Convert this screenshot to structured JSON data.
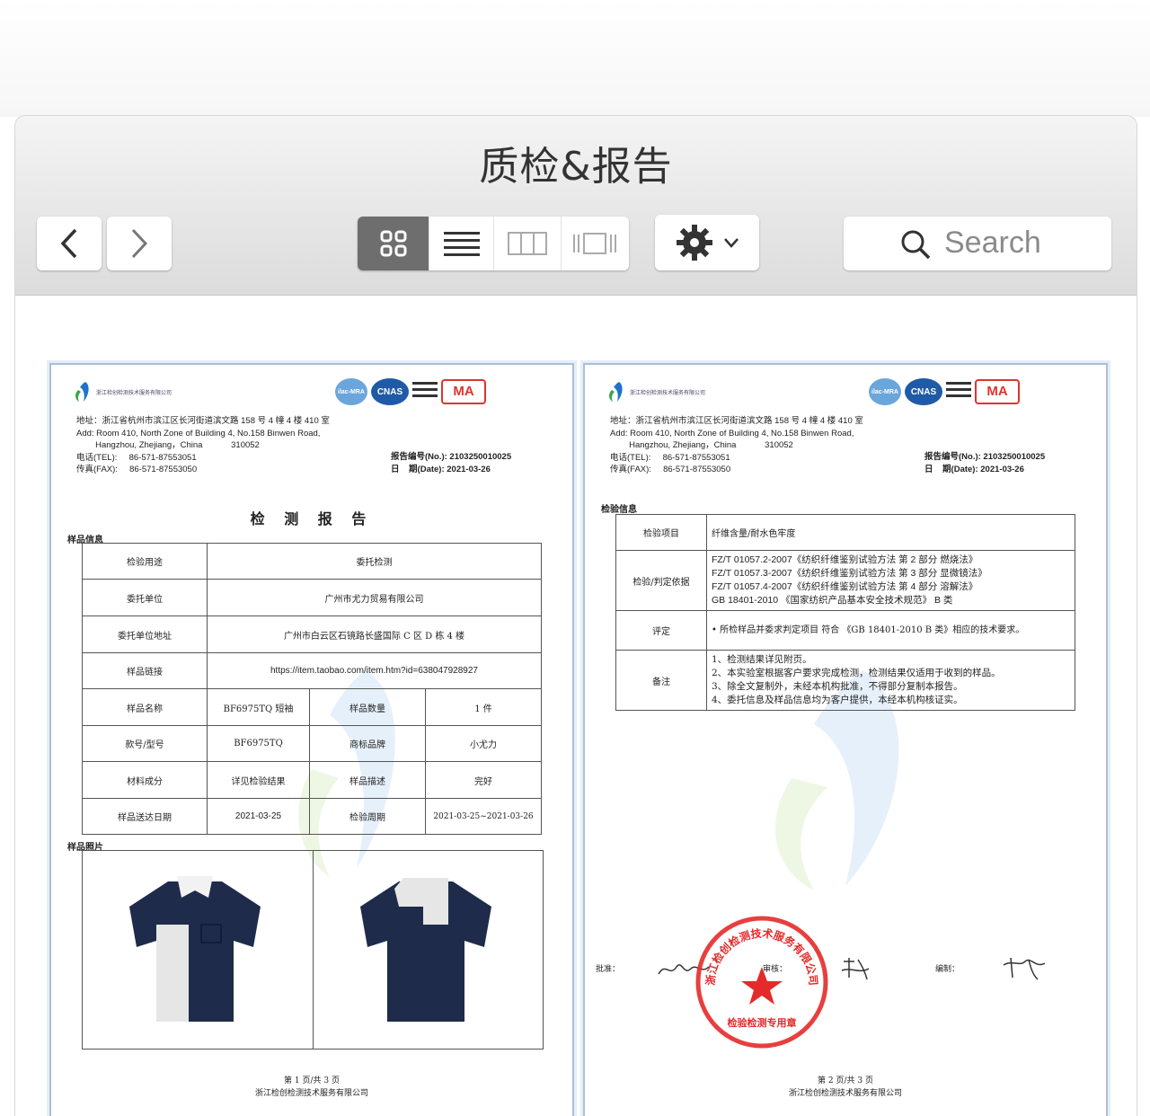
{
  "window": {
    "title": "质检&报告",
    "search_placeholder": "Search",
    "view_modes": [
      "icon-view",
      "list-view",
      "column-view",
      "gallery-view"
    ],
    "active_view": "icon-view"
  },
  "report": {
    "org_name_small": "浙江检创检测技术服务有限公司",
    "cert_labels": [
      "ilac-MRA",
      "CNAS",
      "MA"
    ],
    "address_block": "地址：浙江省杭州市滨江区长河街道滨文路 158 号 4 幢 4 楼 410 室\nAdd: Room 410, North Zone of Building 4, No.158 Binwen Road,\n        Hangzhou, Zhejiang，China            310052\n电话(TEL):     86-571-87553051\n传真(FAX):     86-571-87553050",
    "report_no": "报告编号(No.): 2103250010025",
    "date": "日    期(Date): 2021-03-26"
  },
  "page1": {
    "title": "检 测 报 告",
    "section_sample_info": "样品信息",
    "section_sample_photos": "样品照片",
    "rows": {
      "purpose_k": "检验用途",
      "purpose_v": "委托检测",
      "client_k": "委托单位",
      "client_v": "广州市尤力贸易有限公司",
      "client_addr_k": "委托单位地址",
      "client_addr_v": "广州市白云区石镜路长盛国际 C 区 D 栋 4 楼",
      "link_k": "样品链接",
      "link_v": "https://item.taobao.com/item.htm?id=638047928927",
      "name_k": "样品名称",
      "name_v": "BF6975TQ 短袖",
      "qty_k": "样品数量",
      "qty_v": "1 件",
      "model_k": "款号/型号",
      "model_v": "BF6975TQ",
      "brand_k": "商标品牌",
      "brand_v": "小尤力",
      "material_k": "材料成分",
      "material_v": "详见检验结果",
      "desc_k": "样品描述",
      "desc_v": "完好",
      "sent_k": "样品送达日期",
      "sent_v": "2021-03-25",
      "period_k": "检验周期",
      "period_v": "2021-03-25~2021-03-26"
    },
    "footer_page": "第 1 页/共 3 页",
    "footer_org": "浙江检创检测技术服务有限公司"
  },
  "page2": {
    "section_test_info": "检验信息",
    "item_k": "检验项目",
    "item_v": "纤维含量/耐水色牢度",
    "basis_k": "检验/判定依据",
    "basis_v": "FZ/T 01057.2-2007《纺织纤维鉴别试验方法  第 2 部分  燃烧法》\nFZ/T 01057.3-2007《纺织纤维鉴别试验方法  第 3 部分  显微镜法》\nFZ/T 01057.4-2007《纺织纤维鉴别试验方法  第 4 部分  溶解法》\nGB 18401-2010 《国家纺织产品基本安全技术规范》 B 类",
    "eval_k": "评定",
    "eval_v": "• 所检样品并委求判定项目  符合  《GB 18401-2010 B 类》相应的技术要求。",
    "note_k": "备注",
    "note_v": "1、检测结果详见附页。\n2、本实验室根据客户要求完成检测，检测结果仅适用于收到的样品。\n3、除全文复制外，未经本机构批准，不得部分复制本报告。\n4、委托信息及样品信息均为客户提供，本经本机构核证实。",
    "approve_label": "批准：",
    "review_label": "审核：",
    "compile_label": "编制：",
    "stamp_text": "浙江检创检测技术服务有限公司",
    "stamp_sub": "检验检测专用章",
    "footer_page": "第 2 页/共 3 页",
    "footer_org": "浙江检创检测技术服务有限公司"
  }
}
